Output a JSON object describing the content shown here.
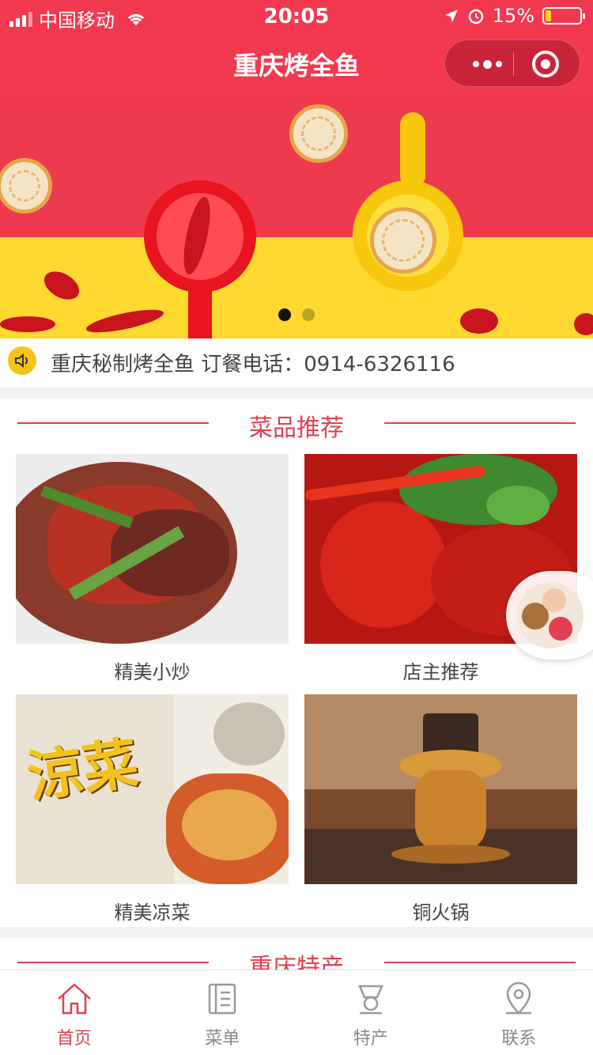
{
  "status_bar": {
    "carrier": "中国移动",
    "time": "20:05",
    "battery": "15%",
    "battery_level": 0.15
  },
  "nav": {
    "title": "重庆烤全鱼"
  },
  "banner": {
    "slides": 2,
    "active_index": 0
  },
  "notice": {
    "text": "重庆秘制烤全鱼 订餐电话：0914-6326116"
  },
  "recommend": {
    "title": "菜品推荐",
    "items": [
      {
        "label": "精美小炒"
      },
      {
        "label": "店主推荐"
      },
      {
        "label": "精美凉菜"
      },
      {
        "label": "铜火锅"
      }
    ]
  },
  "specialty": {
    "title": "重庆特产"
  },
  "tabbar": {
    "items": [
      {
        "label": "首页",
        "icon": "home-icon",
        "active": true
      },
      {
        "label": "菜单",
        "icon": "menu-book-icon",
        "active": false
      },
      {
        "label": "特产",
        "icon": "specialty-icon",
        "active": false
      },
      {
        "label": "联系",
        "icon": "location-icon",
        "active": false
      }
    ]
  },
  "colors": {
    "brand_red": "#f2394f",
    "accent_red": "#e0404f",
    "banner_yellow": "#ffd930"
  }
}
